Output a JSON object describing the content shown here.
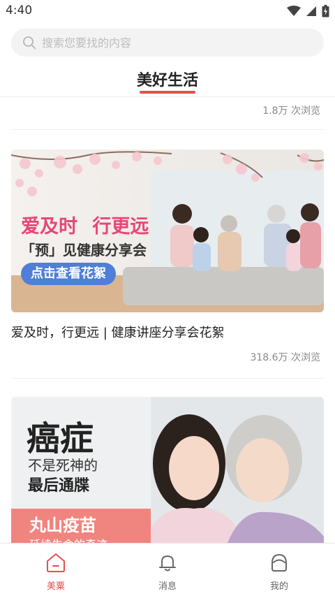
{
  "status_bar": {
    "time": "4:40"
  },
  "search": {
    "placeholder": "搜索您要找的内容"
  },
  "tab": {
    "title": "美好生活"
  },
  "feed": {
    "first_views": "1.8万 次浏览",
    "card2": {
      "title": "爱及时，行更远 | 健康讲座分享会花絮",
      "views": "318.6万 次浏览",
      "banner": {
        "headline_a": "爱及时",
        "headline_b": "行更远",
        "subtitle": "「预」见健康分享会",
        "button": "点击查看花絮"
      }
    },
    "card3": {
      "banner": {
        "headline": "癌症",
        "line1": "不是死神的",
        "line2": "最后通牒",
        "brand": "丸山疫苗",
        "slogan": "延续生命的奇迹"
      }
    }
  },
  "bottom_nav": {
    "items": [
      {
        "label": "美粟",
        "icon": "home-icon",
        "active": true
      },
      {
        "label": "消息",
        "icon": "bell-icon",
        "active": false
      },
      {
        "label": "我的",
        "icon": "profile-icon",
        "active": false
      }
    ]
  },
  "colors": {
    "accent": "#e3504f",
    "banner_pink": "#e8457a",
    "banner_blue": "#4f7fd6",
    "banner_salmon": "#f0857f"
  }
}
